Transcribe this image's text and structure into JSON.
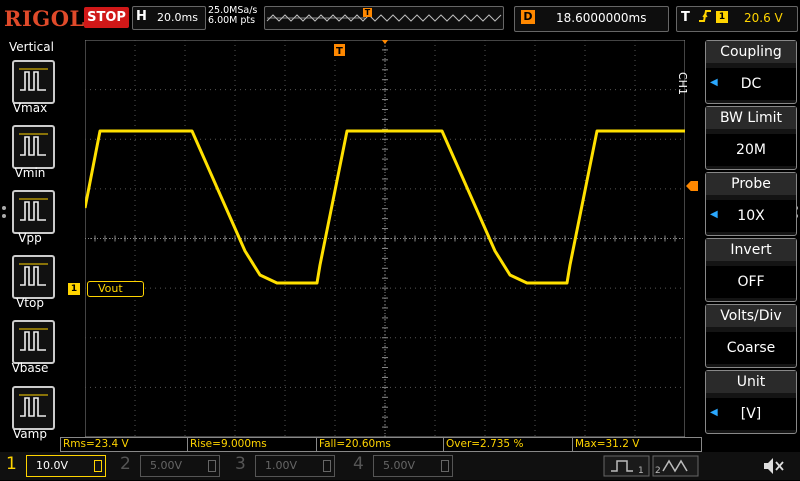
{
  "header": {
    "brand": "RIGOL",
    "run_state": "STOP",
    "horizontal_label": "H",
    "timebase": "20.0ms",
    "sample_rate": "25.0MSa/s",
    "memory_depth": "6.00M pts",
    "trigger_marker": "T",
    "delay_label": "D",
    "delay_value": "18.6000000ms",
    "trigger_label": "T",
    "trigger_channel": "1",
    "trigger_level": "20.6 V"
  },
  "left_panel": {
    "title": "Vertical",
    "items": [
      {
        "label": "Vmax"
      },
      {
        "label": "Vmin"
      },
      {
        "label": "Vpp"
      },
      {
        "label": "Vtop"
      },
      {
        "label": "Vbase"
      },
      {
        "label": "Vamp"
      }
    ]
  },
  "screen": {
    "trigger_top_marker": "T",
    "channel_marker": "1",
    "channel_label": "Vout",
    "trace_color": "#ffe000"
  },
  "right_panel": {
    "channel": "CH1",
    "items": [
      {
        "title": "Coupling",
        "value": "DC",
        "has_arrow": true
      },
      {
        "title": "BW Limit",
        "value": "20M",
        "has_arrow": false
      },
      {
        "title": "Probe",
        "value": "10X",
        "has_arrow": true
      },
      {
        "title": "Invert",
        "value": "OFF",
        "has_arrow": false
      },
      {
        "title": "Volts/Div",
        "value": "Coarse",
        "has_arrow": false
      },
      {
        "title": "Unit",
        "value": "[V]",
        "has_arrow": true
      }
    ]
  },
  "measurements": [
    "Rms=23.4 V",
    "Rise=9.000ms",
    "Fall=20.60ms",
    "Over=2.735 %",
    "Max=31.2 V"
  ],
  "channels_bar": [
    {
      "num": "1",
      "scale": "10.0V",
      "color": "#ffd400"
    },
    {
      "num": "2",
      "scale": "5.00V",
      "color": "#2fc8c8"
    },
    {
      "num": "3",
      "scale": "1.00V",
      "color": "#d020d0"
    },
    {
      "num": "4",
      "scale": "5.00V",
      "color": "#3a70ff"
    }
  ]
}
